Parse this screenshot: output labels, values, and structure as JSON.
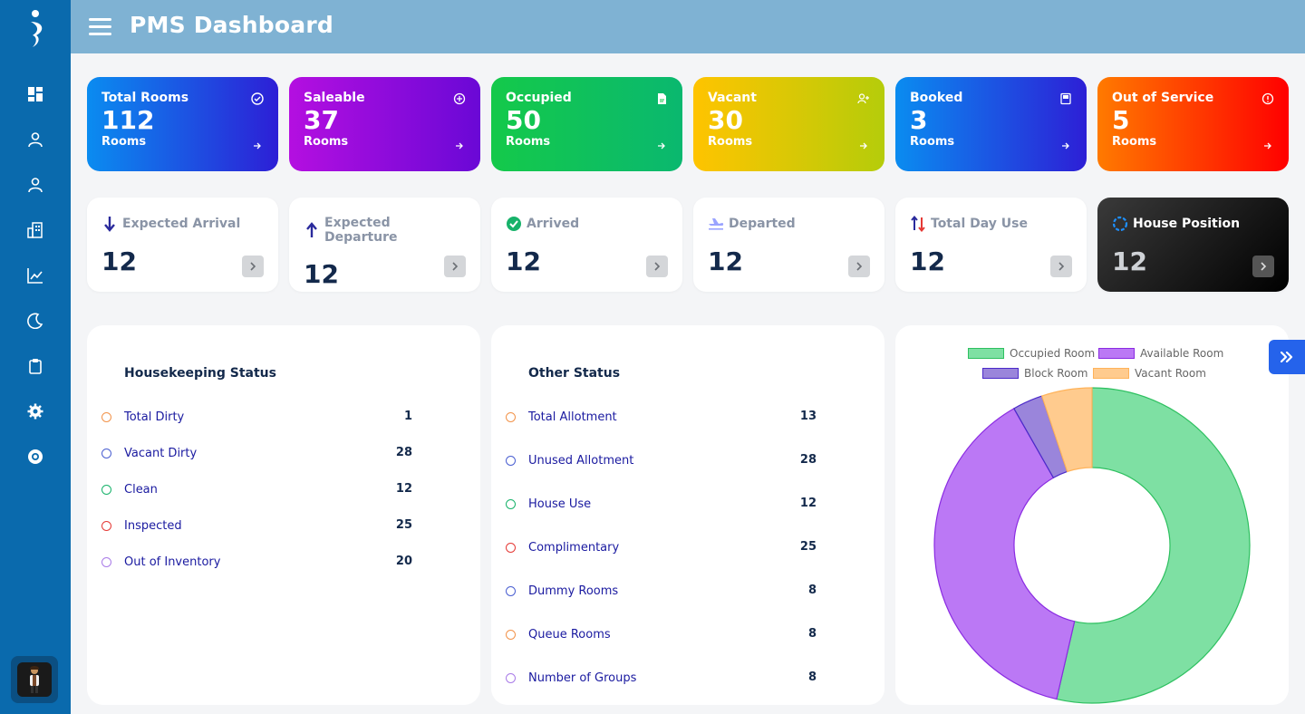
{
  "header": {
    "title": "PMS Dashboard"
  },
  "sidebar": {
    "items": [
      {
        "icon": "dashboard-icon"
      },
      {
        "icon": "user-icon"
      },
      {
        "icon": "guest-icon"
      },
      {
        "icon": "building-icon"
      },
      {
        "icon": "chart-icon"
      },
      {
        "icon": "moon-icon"
      },
      {
        "icon": "clipboard-icon"
      },
      {
        "icon": "gear-icon"
      },
      {
        "icon": "support-icon"
      }
    ]
  },
  "room_cards": [
    {
      "title": "Total Rooms",
      "value": "112",
      "unit": "Rooms",
      "icon": "check-circle-icon",
      "gradient": [
        "#0a8cf0",
        "#2d1fd6"
      ]
    },
    {
      "title": "Saleable",
      "value": "37",
      "unit": "Rooms",
      "icon": "plus-circle-icon",
      "gradient": [
        "#b40fe0",
        "#6a08d6"
      ]
    },
    {
      "title": "Occupied",
      "value": "50",
      "unit": "Rooms",
      "icon": "file-icon",
      "gradient": [
        "#14c94a",
        "#0ab86f"
      ]
    },
    {
      "title": "Vacant",
      "value": "30",
      "unit": "Rooms",
      "icon": "user-plus-icon",
      "gradient": [
        "#ffc400",
        "#b5cc0a"
      ]
    },
    {
      "title": "Booked",
      "value": "3",
      "unit": "Rooms",
      "icon": "book-icon",
      "gradient": [
        "#0a8cf0",
        "#2d1fd6"
      ]
    },
    {
      "title": "Out of Service",
      "value": "5",
      "unit": "Rooms",
      "icon": "alert-circle-icon",
      "gradient": [
        "#ff7a00",
        "#ff0000"
      ]
    }
  ],
  "stat_cards": [
    {
      "title": "Expected Arrival",
      "value": "12",
      "icon": "arrow-down-icon"
    },
    {
      "title": "Expected Departure",
      "value": "12",
      "icon": "arrow-up-icon"
    },
    {
      "title": "Arrived",
      "value": "12",
      "icon": "check-badge-icon"
    },
    {
      "title": "Departed",
      "value": "12",
      "icon": "plane-icon"
    },
    {
      "title": "Total Day Use",
      "value": "12",
      "icon": "swap-vertical-icon"
    },
    {
      "title": "House Position",
      "value": "12",
      "icon": "spinner-icon"
    }
  ],
  "housekeeping": {
    "title": "Housekeeping Status",
    "rows": [
      {
        "label": "Total Dirty",
        "value": "1",
        "color": "#f2934a"
      },
      {
        "label": "Vacant Dirty",
        "value": "28",
        "color": "#4a5fd1"
      },
      {
        "label": "Clean",
        "value": "12",
        "color": "#17b26a"
      },
      {
        "label": "Inspected",
        "value": "25",
        "color": "#e53935"
      },
      {
        "label": "Out of Inventory",
        "value": "20",
        "color": "#a97be8"
      }
    ]
  },
  "other_status": {
    "title": "Other Status",
    "rows": [
      {
        "label": "Total Allotment",
        "value": "13",
        "color": "#f2934a"
      },
      {
        "label": "Unused Allotment",
        "value": "28",
        "color": "#4a5fd1"
      },
      {
        "label": "House Use",
        "value": "12",
        "color": "#17b26a"
      },
      {
        "label": "Complimentary",
        "value": "25",
        "color": "#e53935"
      },
      {
        "label": "Dummy Rooms",
        "value": "8",
        "color": "#4a5fd1"
      },
      {
        "label": "Queue Rooms",
        "value": "8",
        "color": "#f2934a"
      },
      {
        "label": "Number of Groups",
        "value": "8",
        "color": "#a97be8"
      }
    ]
  },
  "chart_data": {
    "type": "pie",
    "donut": true,
    "legend_position": "top",
    "categories": [
      "Occupied Room",
      "Available Room",
      "Block Room",
      "Vacant Room"
    ],
    "values": [
      52,
      37,
      3,
      5
    ],
    "colors": [
      {
        "fill": "#7ee0a3",
        "stroke": "#2ec060"
      },
      {
        "fill": "#bb78f5",
        "stroke": "#8a2be2"
      },
      {
        "fill": "#9a85db",
        "stroke": "#4b2ac9"
      },
      {
        "fill": "#ffcb8e",
        "stroke": "#ffb35a"
      }
    ]
  }
}
